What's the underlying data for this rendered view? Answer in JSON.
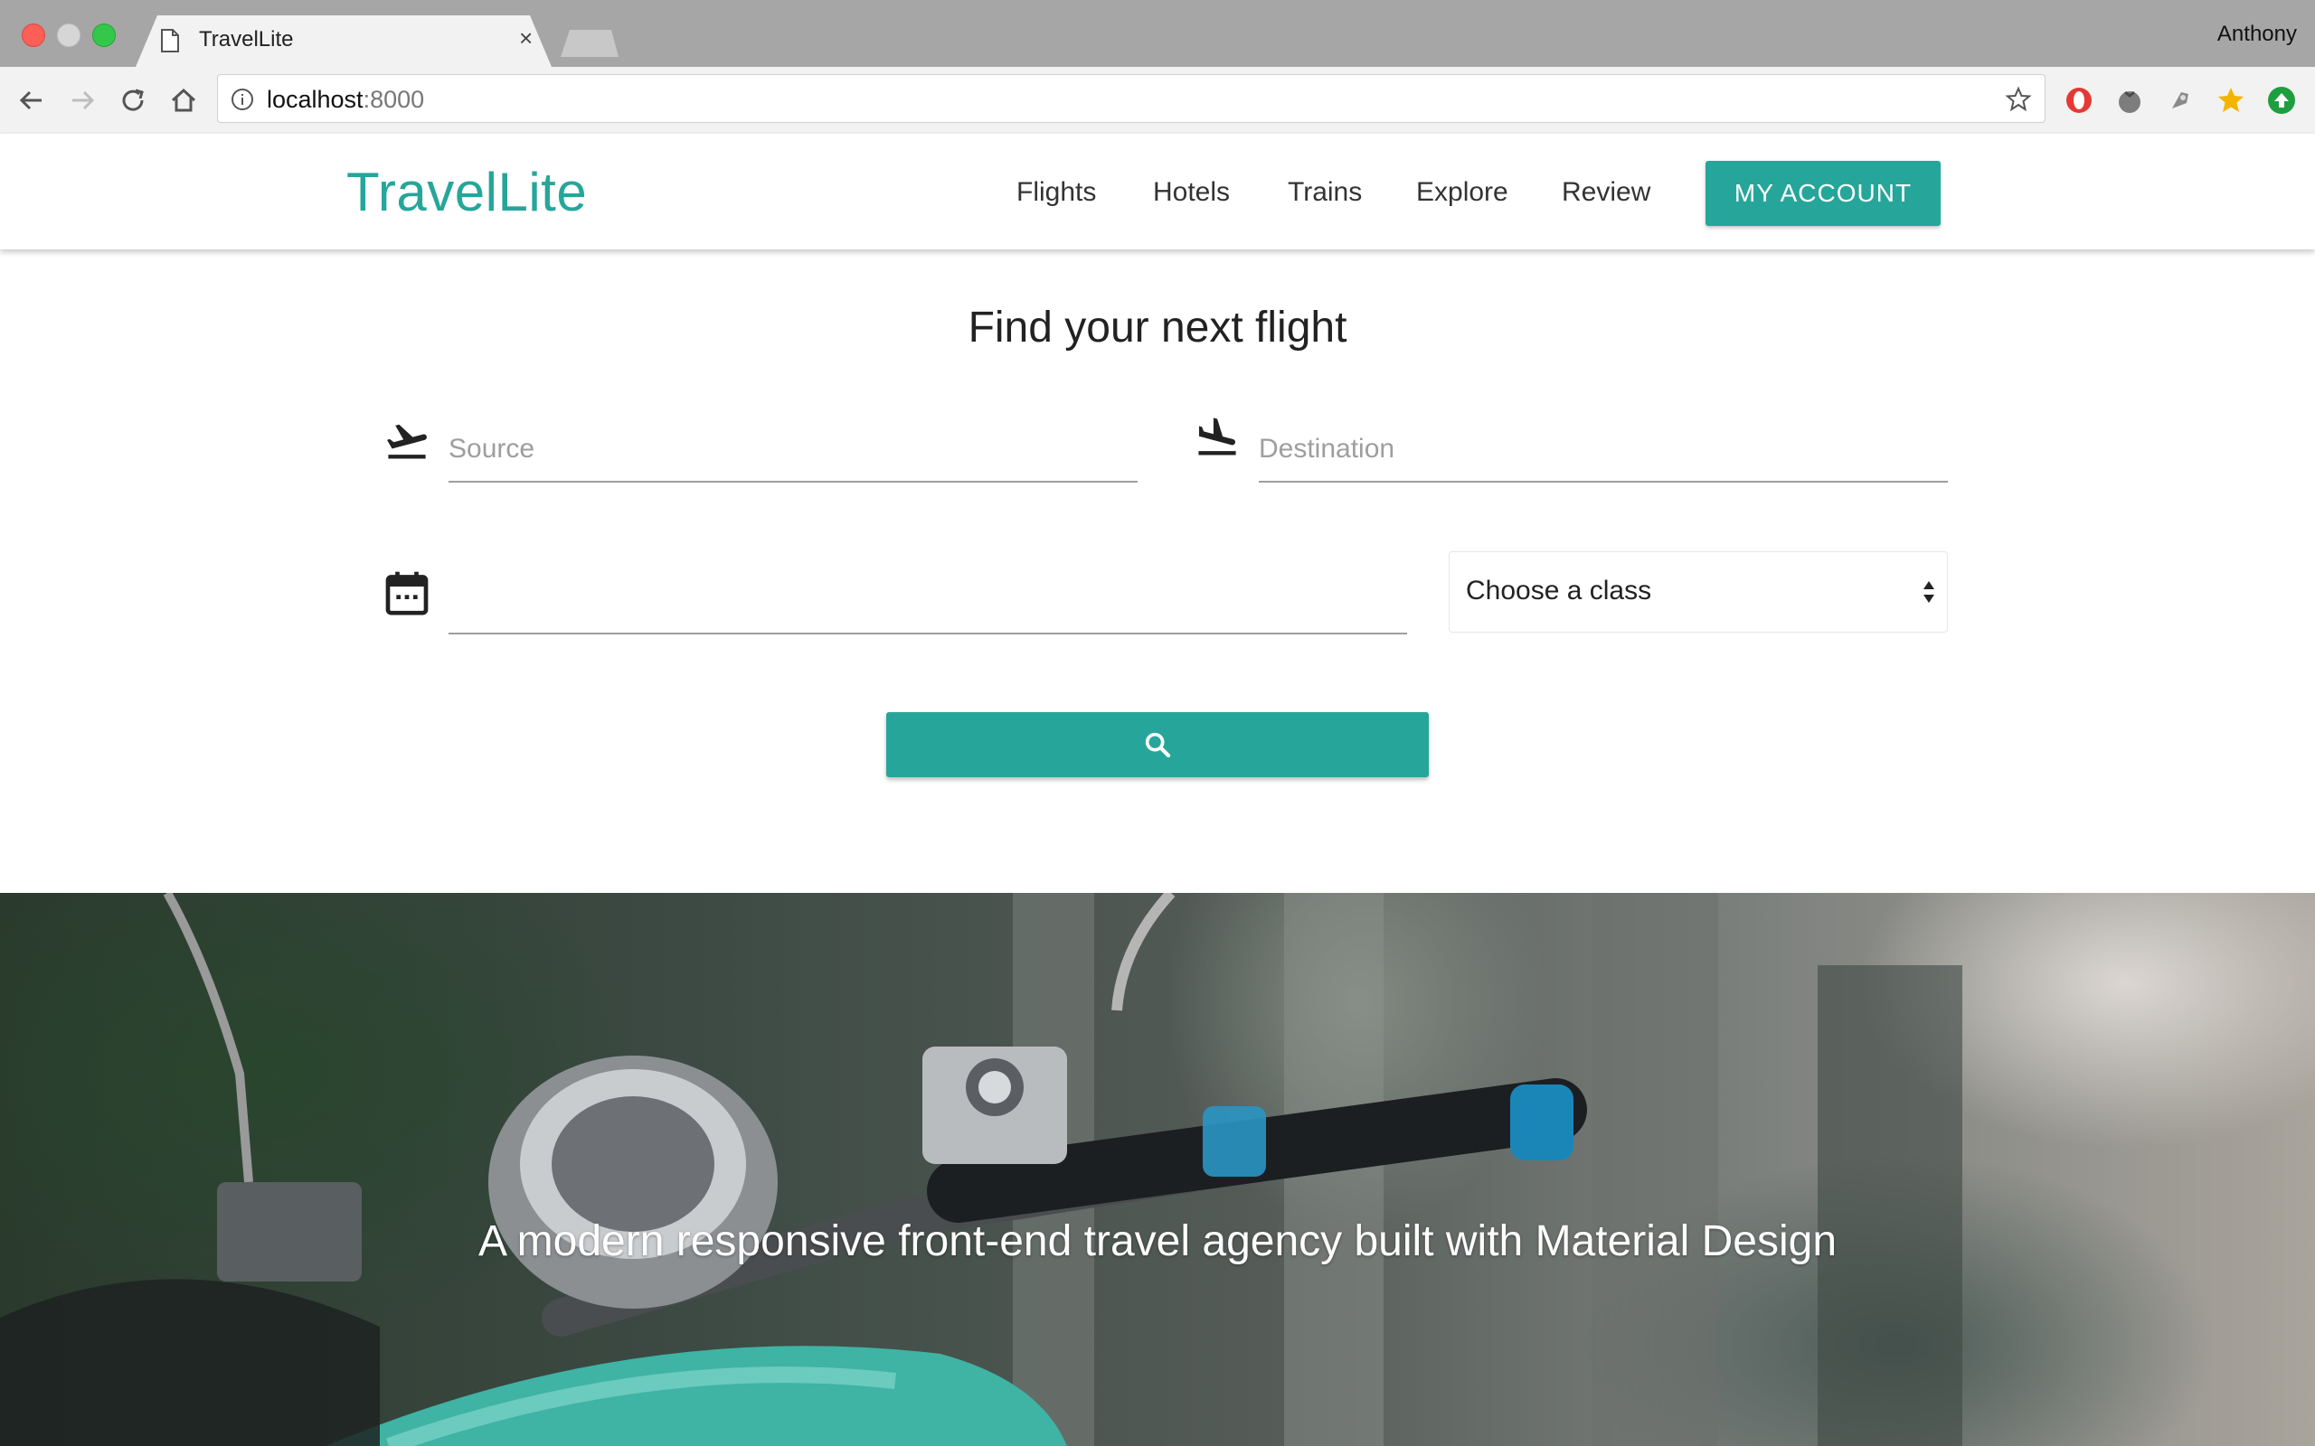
{
  "browser": {
    "tab_title": "TravelLite",
    "tab_close": "×",
    "profile_name": "Anthony",
    "url_host": "localhost",
    "url_port": ":8000"
  },
  "site": {
    "brand": "TravelLite",
    "nav": [
      "Flights",
      "Hotels",
      "Trains",
      "Explore",
      "Review"
    ],
    "account_button": "MY ACCOUNT"
  },
  "search": {
    "heading": "Find your next flight",
    "source_placeholder": "Source",
    "destination_placeholder": "Destination",
    "date_value": "",
    "class_selected": "Choose a class"
  },
  "hero": {
    "tagline": "A modern responsive front-end travel agency built with Material Design"
  },
  "colors": {
    "accent": "#26a69a"
  }
}
